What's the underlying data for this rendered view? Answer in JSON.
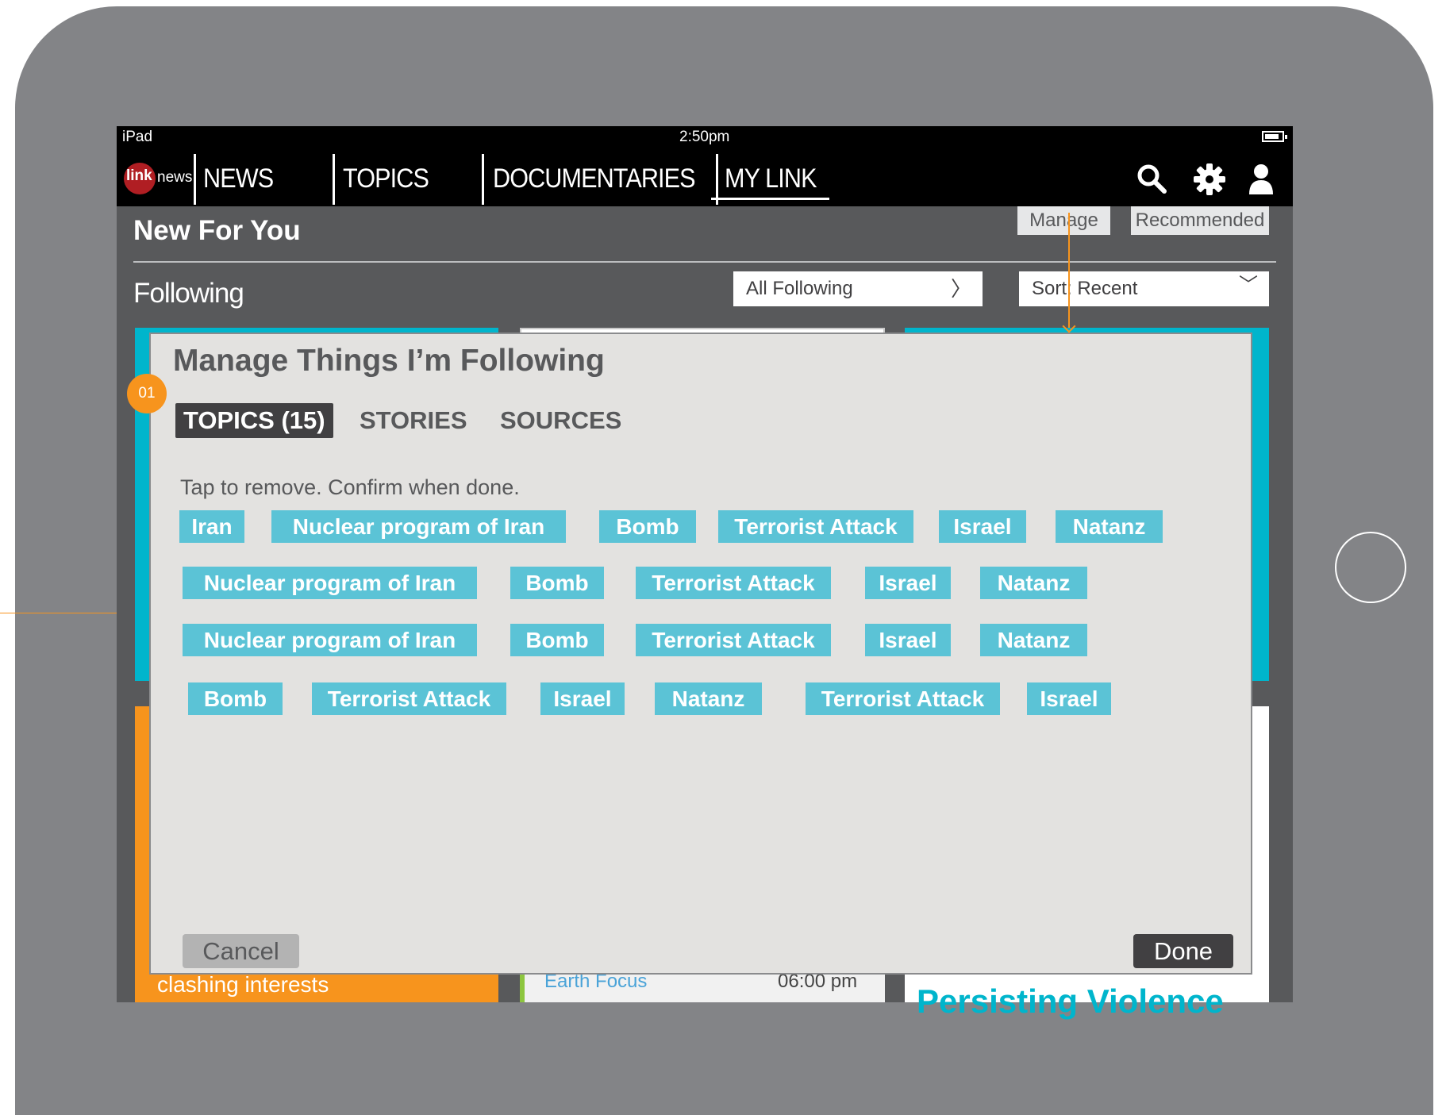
{
  "status_bar": {
    "device": "iPad",
    "time": "2:50pm"
  },
  "nav": {
    "logo_link": "link",
    "logo_news": "news",
    "items": [
      "NEWS",
      "TOPICS",
      "DOCUMENTARIES",
      "MY LINK"
    ],
    "active": "MY LINK"
  },
  "header": {
    "title": "New For You",
    "manage_label": "Manage",
    "recommended_label": "Recommended",
    "following_label": "Following",
    "filter_value": "All Following",
    "sort_value": "Sort: Recent"
  },
  "background_cards": {
    "orange_text": "clashing interests",
    "earth_focus": "Earth Focus",
    "time": "06:00 pm",
    "headline": "Persisting Violence"
  },
  "modal": {
    "badge": "01",
    "title": "Manage Things I’m Following",
    "tabs": [
      "TOPICS (15)",
      "STORIES",
      "SOURCES"
    ],
    "hint": "Tap to remove. Confirm when done.",
    "rows": [
      [
        "Iran",
        "Nuclear program of Iran",
        "Bomb",
        "Terrorist Attack",
        "Israel",
        "Natanz"
      ],
      [
        "Nuclear program of Iran",
        "Bomb",
        "Terrorist Attack",
        "Israel",
        "Natanz"
      ],
      [
        "Nuclear program of Iran",
        "Bomb",
        "Terrorist Attack",
        "Israel",
        "Natanz"
      ],
      [
        "Bomb",
        "Terrorist Attack",
        "Israel",
        "Natanz",
        "Terrorist Attack",
        "Israel"
      ]
    ],
    "cancel_label": "Cancel",
    "done_label": "Done"
  },
  "colors": {
    "accent_teal": "#00b5cc",
    "chip": "#5bc3d6",
    "accent_orange": "#f7941d",
    "dark": "#414042"
  }
}
